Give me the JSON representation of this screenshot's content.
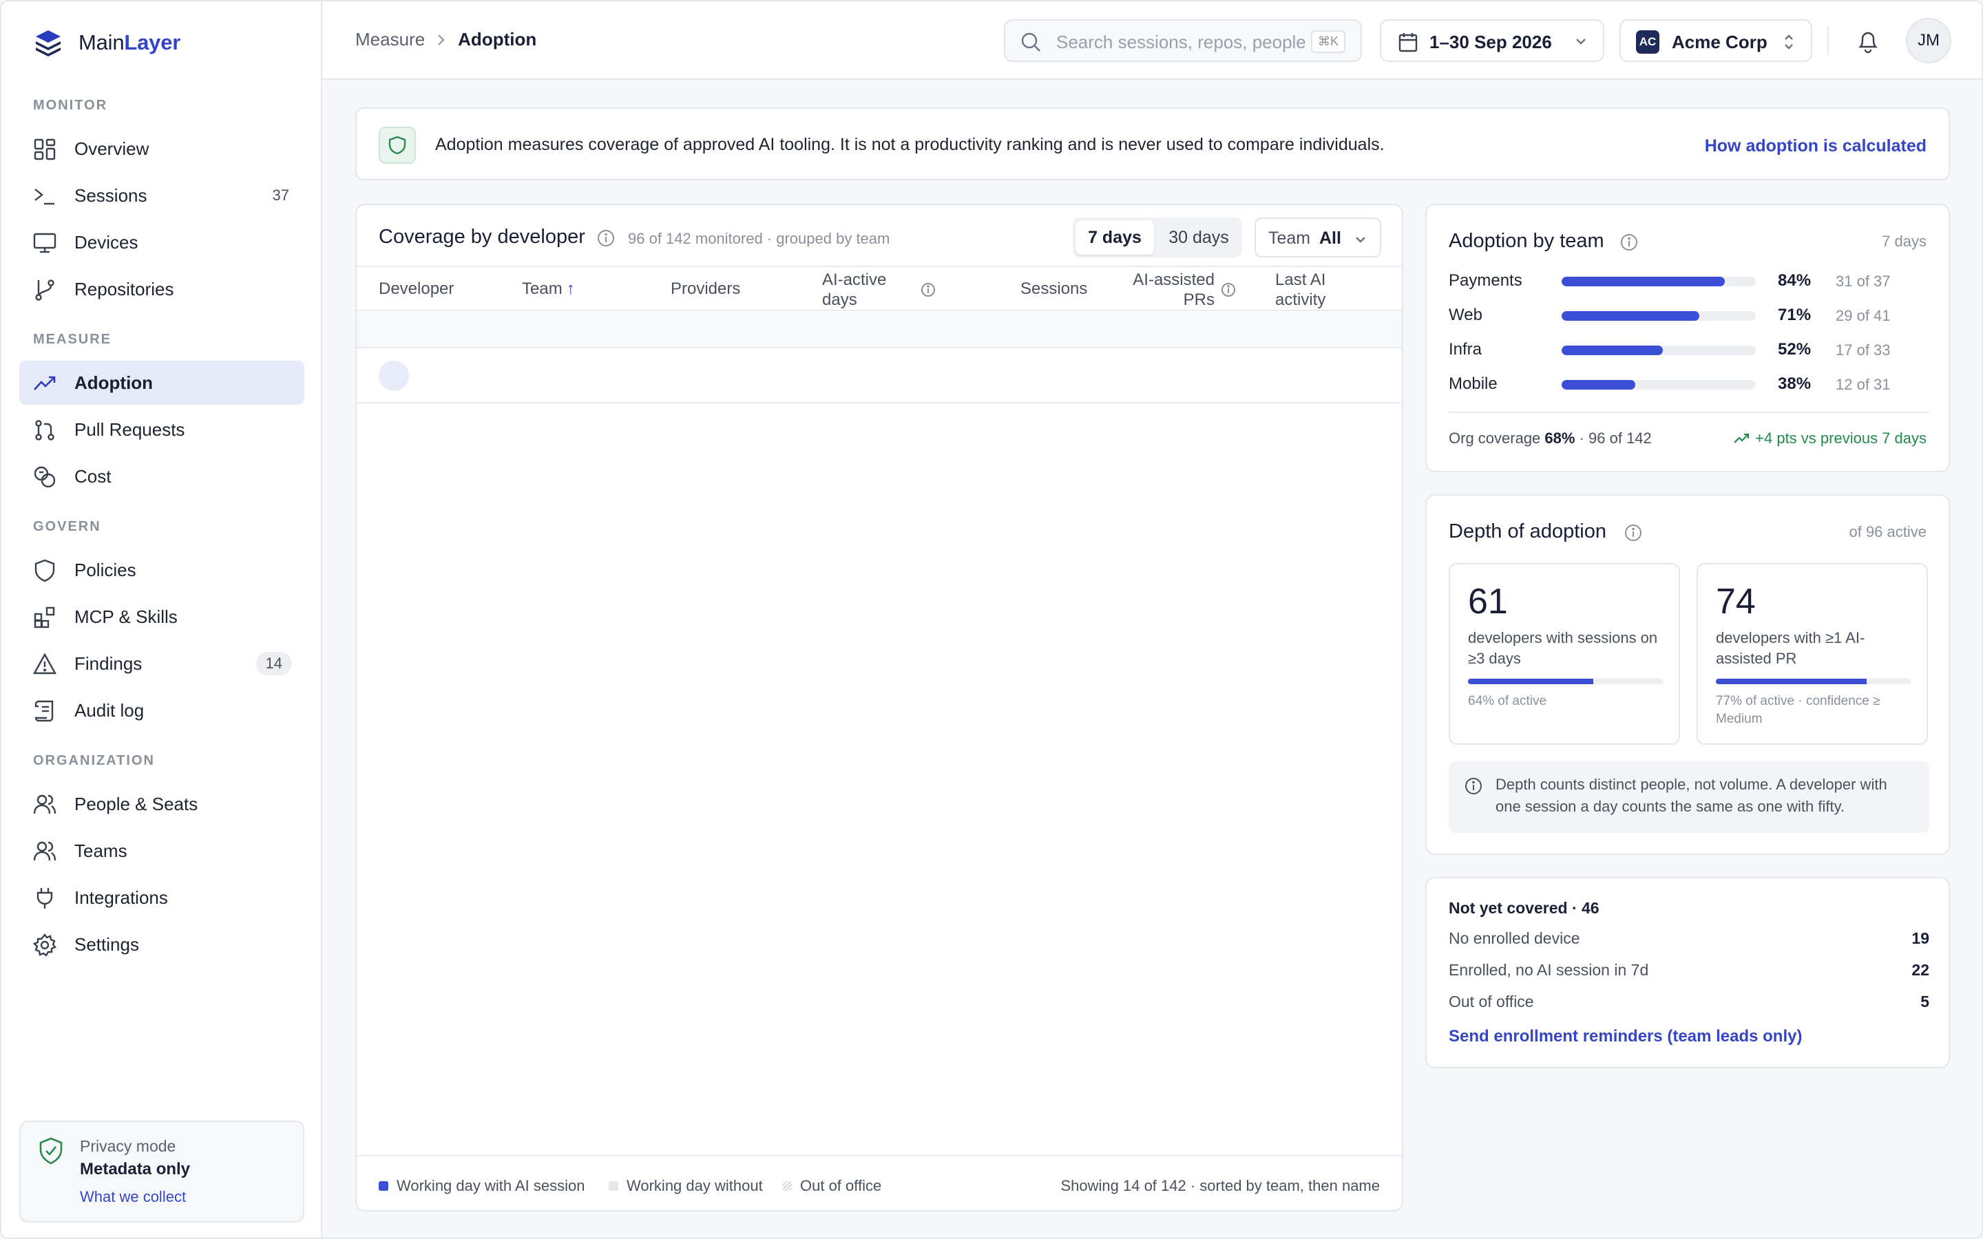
{
  "brand": {
    "name_part1": "Main",
    "name_part2": "Layer"
  },
  "sidebar": {
    "sections": [
      {
        "label": "MONITOR"
      },
      {
        "label": "MEASURE"
      },
      {
        "label": "GOVERN"
      },
      {
        "label": "ORGANIZATION"
      }
    ],
    "items": [
      {
        "label": "Overview",
        "icon": "grid-icon"
      },
      {
        "label": "Sessions",
        "icon": "terminal-icon",
        "count": "37"
      },
      {
        "label": "Devices",
        "icon": "monitor-icon"
      },
      {
        "label": "Repositories",
        "icon": "branch-icon"
      },
      {
        "label": "Adoption",
        "icon": "trending-up-icon",
        "active": true
      },
      {
        "label": "Pull Requests",
        "icon": "pull-request-icon"
      },
      {
        "label": "Cost",
        "icon": "coins-icon"
      },
      {
        "label": "Policies",
        "icon": "shield-icon"
      },
      {
        "label": "MCP & Skills",
        "icon": "blocks-icon"
      },
      {
        "label": "Findings",
        "icon": "warning-icon",
        "count": "14"
      },
      {
        "label": "Audit log",
        "icon": "scroll-icon"
      },
      {
        "label": "People & Seats",
        "icon": "users-icon"
      },
      {
        "label": "Teams",
        "icon": "team-icon"
      },
      {
        "label": "Integrations",
        "icon": "plug-icon"
      },
      {
        "label": "Settings",
        "icon": "gear-icon"
      }
    ],
    "privacy": {
      "label": "Privacy mode",
      "value": "Metadata only",
      "link": "What we collect"
    }
  },
  "topbar": {
    "breadcrumb": [
      "Measure",
      "Adoption"
    ],
    "search_placeholder": "Search sessions, repos, people",
    "search_shortcut": "⌘K",
    "date_range": "1–30 Sep 2026",
    "org_initials": "AC",
    "org_name": "Acme Corp",
    "user_initials": "JM"
  },
  "notice": {
    "text": "Adoption measures coverage of approved AI tooling. It is not a productivity ranking and is never used to compare individuals.",
    "link": "How adoption is calculated"
  },
  "coverage": {
    "title": "Coverage by developer",
    "subtitle": "96 of 142 monitored · grouped by team",
    "range_options": [
      "7 days",
      "30 days"
    ],
    "selected_range": "7 days",
    "team_filter_label": "Team",
    "team_filter_value": "All",
    "columns": [
      {
        "line1": "Developer",
        "line2": ""
      },
      {
        "line1": "Team",
        "line2": "",
        "sorted": "↑"
      },
      {
        "line1": "Providers",
        "line2": ""
      },
      {
        "line1": "AI-active",
        "line2": "days"
      },
      {
        "line1": "Sessions",
        "line2": ""
      },
      {
        "line1": "AI-assisted",
        "line2": "PRs"
      },
      {
        "line1": "Last AI",
        "line2": "activity"
      }
    ],
    "legend": [
      {
        "label": "Working day with AI session",
        "color": "#3a4fd6"
      },
      {
        "label": "Working day without",
        "color": "#e4e6ea"
      },
      {
        "label": "Out of office",
        "color": "hatched"
      }
    ],
    "footer_note": "Showing 14 of 142 · sorted by team, then name"
  },
  "adoption_by_team": {
    "title": "Adoption by team",
    "range": "7 days",
    "teams": [
      {
        "name": "Payments",
        "pct": 84,
        "pct_label": "84%",
        "of": "31 of 37"
      },
      {
        "name": "Web",
        "pct": 71,
        "pct_label": "71%",
        "of": "29 of 41"
      },
      {
        "name": "Infra",
        "pct": 52,
        "pct_label": "52%",
        "of": "17 of 33"
      },
      {
        "name": "Mobile",
        "pct": 38,
        "pct_label": "38%",
        "of": "12 of 31"
      }
    ],
    "org_label": "Org coverage",
    "org_pct": "68%",
    "org_of": "· 96 of 142",
    "trend": "+4 pts vs previous 7 days"
  },
  "depth": {
    "title": "Depth of adoption",
    "range": "of 96 active",
    "stats": [
      {
        "value": "61",
        "desc": "developers with sessions on ≥3 days",
        "fill": 64,
        "note": "64% of active"
      },
      {
        "value": "74",
        "desc": "developers with ≥1 AI-assisted PR",
        "fill": 77,
        "note": "77% of active · confidence ≥ Medium"
      }
    ],
    "callout": "Depth counts distinct people, not volume. A developer with one session a day counts the same as one with fifty."
  },
  "not_covered": {
    "title": "Not yet covered · 46",
    "rows": [
      {
        "label": "No enrolled device",
        "value": "19"
      },
      {
        "label": "Enrolled, no AI session in 7d",
        "value": "22"
      },
      {
        "label": "Out of office",
        "value": "5"
      }
    ],
    "link": "Send enrollment reminders (team leads only)"
  }
}
